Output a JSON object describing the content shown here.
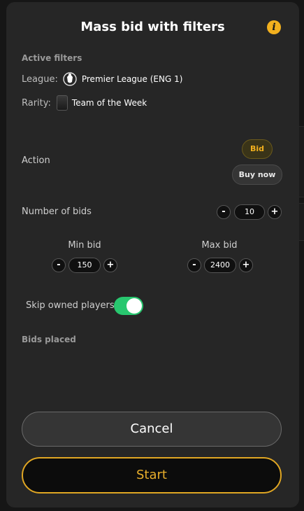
{
  "modal": {
    "title": "Mass bid with filters",
    "info_icon": "info-icon"
  },
  "filters": {
    "heading": "Active filters",
    "league": {
      "key": "League:",
      "value": "Premier League (ENG 1)",
      "icon": "premier-league-icon"
    },
    "rarity": {
      "key": "Rarity:",
      "value": "Team of the Week",
      "icon": "team-of-the-week-card-icon"
    }
  },
  "action": {
    "label": "Action",
    "options": [
      {
        "label": "Bid",
        "selected": true
      },
      {
        "label": "Buy now",
        "selected": false
      }
    ]
  },
  "number_of_bids": {
    "label": "Number of bids",
    "value": "10"
  },
  "min_bid": {
    "label": "Min bid",
    "value": "150"
  },
  "max_bid": {
    "label": "Max bid",
    "value": "2400"
  },
  "stepper_symbols": {
    "minus": "-",
    "plus": "+"
  },
  "skip_owned": {
    "label": "Skip owned players",
    "enabled": true
  },
  "bids_placed": {
    "heading": "Bids placed"
  },
  "buttons": {
    "cancel": "Cancel",
    "start": "Start"
  },
  "colors": {
    "accent": "#f2b01e",
    "toggle_on": "#28c76f",
    "modal_bg": "#262626",
    "page_bg": "#161616"
  }
}
